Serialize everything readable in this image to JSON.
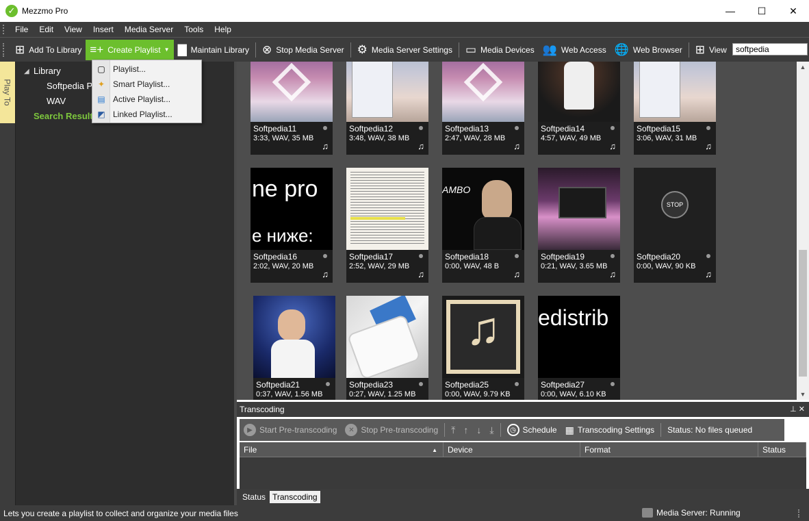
{
  "window": {
    "title": "Mezzmo Pro",
    "minimize": "—",
    "maximize": "☐",
    "close": "✕"
  },
  "menu": [
    "File",
    "Edit",
    "View",
    "Insert",
    "Media Server",
    "Tools",
    "Help"
  ],
  "toolbar": {
    "add_to_library": "Add To Library",
    "create_playlist": "Create Playlist",
    "maintain_library": "Maintain Library",
    "stop_media_server": "Stop Media Server",
    "media_server_settings": "Media Server Settings",
    "media_devices": "Media Devices",
    "web_access": "Web Access",
    "web_browser": "Web Browser",
    "view": "View",
    "search_value": "softpedia"
  },
  "colors": {
    "accent": "#6cbf2d",
    "dark": "#3c3c3c",
    "search_results": "#7dc73d"
  },
  "play_to": "Play To",
  "tree": {
    "library": "Library",
    "softpedia_playlist": "Softpedia P",
    "wav": "WAV",
    "search_results": "Search Results"
  },
  "dropdown": [
    {
      "label": "Playlist...",
      "icon": "playlist-icon"
    },
    {
      "label": "Smart Playlist...",
      "icon": "smart-playlist-icon"
    },
    {
      "label": "Active Playlist...",
      "icon": "active-playlist-icon"
    },
    {
      "label": "Linked Playlist...",
      "icon": "linked-playlist-icon"
    }
  ],
  "tiles": [
    {
      "name": "Softpedia11",
      "meta": "3:33, WAV, 35 MB"
    },
    {
      "name": "Softpedia12",
      "meta": "3:48, WAV, 38 MB"
    },
    {
      "name": "Softpedia13",
      "meta": "2:47, WAV, 28 MB"
    },
    {
      "name": "Softpedia14",
      "meta": "4:57, WAV, 49 MB"
    },
    {
      "name": "Softpedia15",
      "meta": "3:06, WAV, 31 MB"
    },
    {
      "name": "Softpedia16",
      "meta": "2:02, WAV, 20 MB",
      "thumb_text": "ne pro",
      "thumb_text2": "е ниже:"
    },
    {
      "name": "Softpedia17",
      "meta": "2:52, WAV, 29 MB"
    },
    {
      "name": "Softpedia18",
      "meta": "0:00, WAV, 48 B",
      "thumb_text": "AMBO"
    },
    {
      "name": "Softpedia19",
      "meta": "0:21, WAV, 3.65 MB"
    },
    {
      "name": "Softpedia20",
      "meta": "0:00, WAV, 90 KB",
      "thumb_text": "STOP"
    },
    {
      "name": "Softpedia21",
      "meta": "0:37, WAV, 1.56 MB"
    },
    {
      "name": "Softpedia23",
      "meta": "0:27, WAV, 1.25 MB"
    },
    {
      "name": "Softpedia25",
      "meta": "0:00, WAV, 9.79 KB"
    },
    {
      "name": "Softpedia27",
      "meta": "0:00, WAV, 6.10 KB",
      "thumb_text": "edistrib"
    }
  ],
  "transcoding": {
    "title": "Transcoding",
    "start": "Start Pre-transcoding",
    "stop": "Stop Pre-transcoding",
    "schedule": "Schedule",
    "settings": "Transcoding Settings",
    "status": "Status: No files queued",
    "columns": [
      "File",
      "Device",
      "Format",
      "Status"
    ]
  },
  "bottom_tabs": [
    "Status",
    "Transcoding"
  ],
  "statusbar": {
    "message": "Lets you create a playlist to collect and organize your media files",
    "server": "Media Server: Running"
  }
}
